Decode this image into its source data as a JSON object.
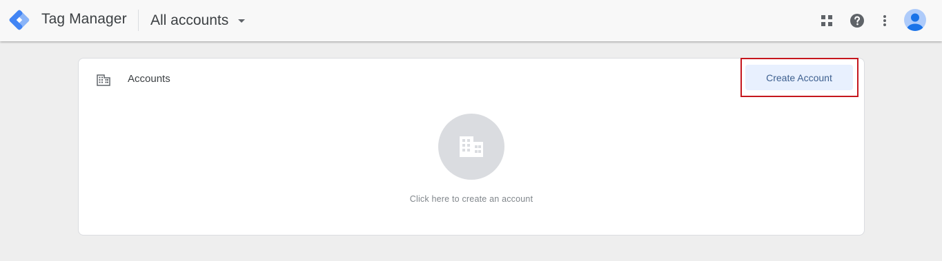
{
  "header": {
    "product_name": "Tag Manager",
    "account_switcher_label": "All accounts",
    "icons": [
      "gtm-logo-icon",
      "apps-grid-icon",
      "help-icon",
      "more-vert-icon",
      "account-avatar-icon"
    ]
  },
  "accounts_card": {
    "title": "Accounts",
    "create_button_label": "Create Account",
    "empty_state_text": "Click here to create an account",
    "icons": [
      "building-icon"
    ]
  },
  "colors": {
    "brand_blue": "#4285f4",
    "brand_light_blue": "#8ab4f8",
    "button_bg": "#e8f0fe",
    "button_text": "#3d5f8f",
    "highlight_red": "#c5161d",
    "page_bg": "#eeeeee"
  }
}
